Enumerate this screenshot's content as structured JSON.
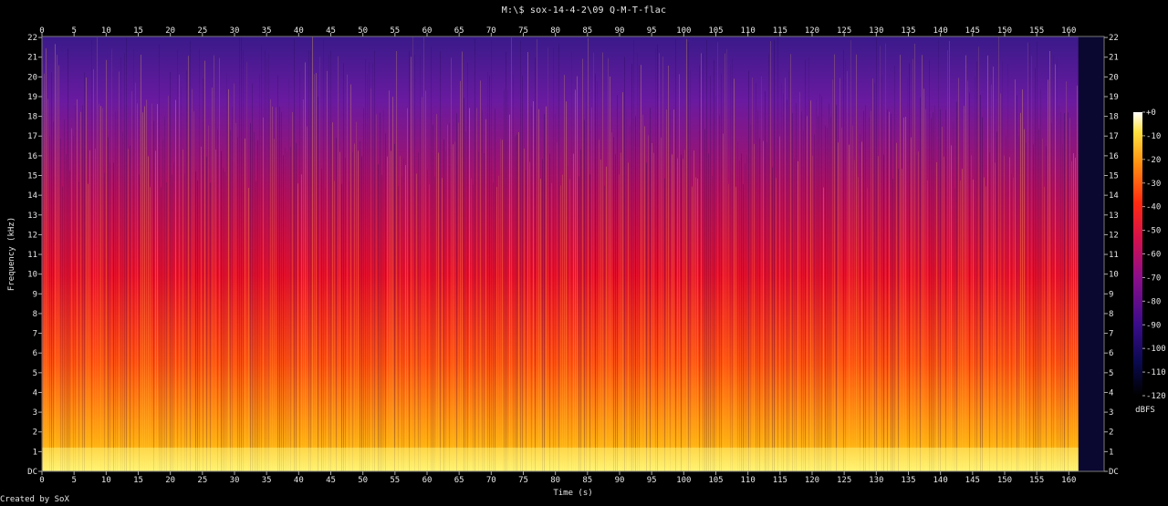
{
  "window": {
    "title": "M:\\$ sox-14-4-2\\09 Q-M-T-flac",
    "credit": "Created by SoX"
  },
  "chart_data": {
    "type": "heatmap",
    "title": "M:\\$ sox-14-4-2\\09 Q-M-T-flac",
    "xlabel": "Time (s)",
    "ylabel": "Frequency (kHz)",
    "x_ticks": [
      "0",
      "5",
      "10",
      "15",
      "20",
      "25",
      "30",
      "35",
      "40",
      "45",
      "50",
      "55",
      "60",
      "65",
      "70",
      "75",
      "80",
      "85",
      "90",
      "95",
      "100",
      "105",
      "110",
      "115",
      "120",
      "125",
      "130",
      "135",
      "140",
      "145",
      "150",
      "155",
      "160"
    ],
    "y_ticks": [
      "DC",
      "1",
      "2",
      "3",
      "4",
      "5",
      "6",
      "7",
      "8",
      "9",
      "10",
      "11",
      "12",
      "13",
      "14",
      "15",
      "16",
      "17",
      "18",
      "19",
      "20",
      "21",
      "22"
    ],
    "xlim": [
      0,
      165.5
    ],
    "ylim": [
      0,
      22.05
    ],
    "colorbar": {
      "label": "dBFS",
      "ticks": [
        "+0",
        "-10",
        "-20",
        "-30",
        "-40",
        "-50",
        "-60",
        "-70",
        "-80",
        "-90",
        "-100",
        "-110",
        "-120"
      ],
      "range": [
        -120,
        0
      ]
    },
    "colors": {
      "background": "#000000",
      "low": "#0b0228",
      "mid_low": "#5a1ba8",
      "mid": "#c0125c",
      "mid_high": "#ff2a10",
      "high": "#ff9a10",
      "peak": "#ffff9a"
    }
  }
}
